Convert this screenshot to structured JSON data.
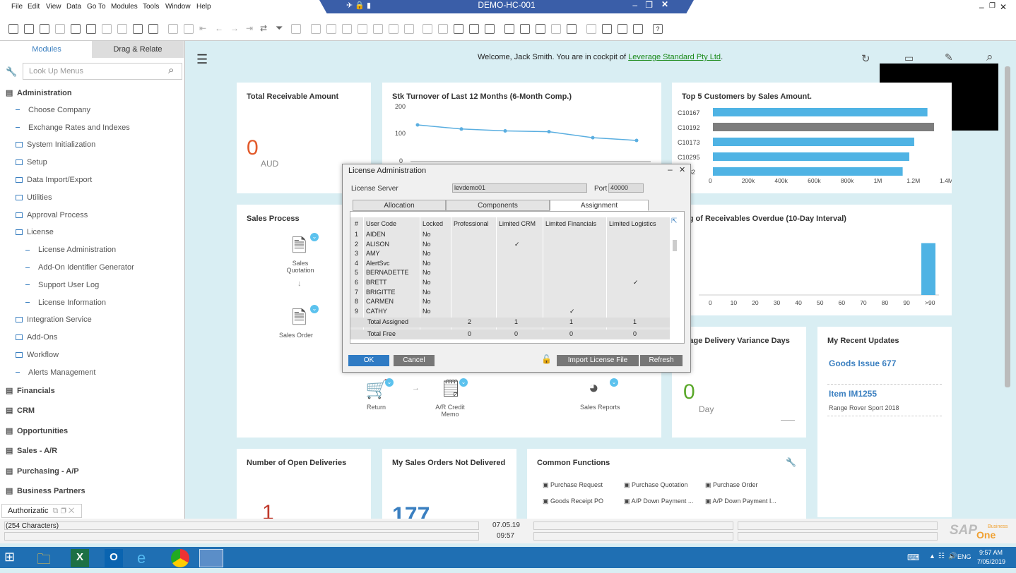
{
  "menu": [
    "File",
    "Edit",
    "View",
    "Data",
    "Go To",
    "Modules",
    "Tools",
    "Window",
    "Help"
  ],
  "window_title": "DEMO-HC-001",
  "sidebar": {
    "tabs": [
      "Modules",
      "Drag & Relate"
    ],
    "search_placeholder": "Look Up Menus",
    "items": [
      {
        "label": "Administration",
        "level": "top"
      },
      {
        "label": "Choose Company",
        "level": "leaf"
      },
      {
        "label": "Exchange Rates and Indexes",
        "level": "leaf"
      },
      {
        "label": "System Initialization",
        "level": "folder"
      },
      {
        "label": "Setup",
        "level": "folder"
      },
      {
        "label": "Data Import/Export",
        "level": "folder"
      },
      {
        "label": "Utilities",
        "level": "folder"
      },
      {
        "label": "Approval Process",
        "level": "folder"
      },
      {
        "label": "License",
        "level": "folder"
      },
      {
        "label": "License Administration",
        "level": "subleaf"
      },
      {
        "label": "Add-On Identifier Generator",
        "level": "subleaf"
      },
      {
        "label": "Support User Log",
        "level": "subleaf"
      },
      {
        "label": "License Information",
        "level": "subleaf"
      },
      {
        "label": "Integration Service",
        "level": "folder"
      },
      {
        "label": "Add-Ons",
        "level": "folder"
      },
      {
        "label": "Workflow",
        "level": "folder"
      },
      {
        "label": "Alerts Management",
        "level": "leaf"
      },
      {
        "label": "Financials",
        "level": "top"
      },
      {
        "label": "CRM",
        "level": "top"
      },
      {
        "label": "Opportunities",
        "level": "top"
      },
      {
        "label": "Sales - A/R",
        "level": "top"
      },
      {
        "label": "Purchasing - A/P",
        "level": "top"
      },
      {
        "label": "Business Partners",
        "level": "top"
      }
    ],
    "bottom_tab": "Authorizatic"
  },
  "welcome": {
    "text": "Welcome, Jack Smith. You are in cockpit of",
    "company": "Leverage Standard Pty Ltd",
    "dot": "."
  },
  "cards": {
    "receivable": {
      "title": "Total Receivable Amount",
      "value": "0",
      "unit": "AUD"
    },
    "turnover": {
      "title": "Stk Turnover of Last 12 Months (6-Month Comp.)",
      "yticks": [
        "200",
        "100",
        "0"
      ]
    },
    "top5": {
      "title": "Top 5 Customers by Sales Amount.",
      "customers": [
        "C10167",
        "C10192",
        "C10173",
        "C10295",
        "10282"
      ],
      "xticks": [
        "0",
        "200k",
        "400k",
        "600k",
        "800k",
        "1M",
        "1.2M",
        "1.4M"
      ]
    },
    "sales_process": {
      "title": "Sales Process",
      "quotation": "Sales Quotation",
      "order": "Sales Order",
      "return": "Return",
      "credit": "A/R Credit Memo",
      "reports": "Sales Reports"
    },
    "aging": {
      "title": "ing of Receivables Overdue (10-Day Interval)",
      "xticks": [
        "0",
        "10",
        "20",
        "30",
        "40",
        "50",
        "60",
        "70",
        "80",
        "90",
        ">90"
      ]
    },
    "delivery_var": {
      "title": "erage Delivery Variance Days",
      "value": "0",
      "unit": "Day"
    },
    "recent": {
      "title": "My Recent Updates",
      "item1": "Goods Issue 677",
      "item2": "Item IM1255",
      "item2_sub": "Range Rover Sport 2018"
    },
    "open_deliveries": {
      "title": "Number of Open Deliveries",
      "value": "1"
    },
    "not_delivered": {
      "title": "My Sales Orders Not Delivered",
      "value": "177"
    },
    "common": {
      "title": "Common Functions",
      "f": [
        "Purchase Request",
        "Purchase Quotation",
        "Purchase Order",
        "Goods Receipt PO",
        "A/P Down Payment ...",
        "A/P Down Payment I..."
      ]
    }
  },
  "chart_data": [
    {
      "type": "line",
      "title": "Stk Turnover of Last 12 Months (6-Month Comp.)",
      "x": [
        1,
        2,
        3,
        4,
        5,
        6
      ],
      "values": [
        135,
        120,
        113,
        110,
        88,
        78
      ],
      "ylim": [
        0,
        200
      ]
    },
    {
      "type": "bar",
      "title": "Top 5 Customers by Sales Amount.",
      "categories": [
        "C10167",
        "C10192",
        "C10173",
        "C10295",
        "10282"
      ],
      "values": [
        1300000,
        1340000,
        1220000,
        1190000,
        1150000
      ],
      "xlim": [
        0,
        1400000
      ]
    },
    {
      "type": "bar",
      "title": "ing of Receivables Overdue (10-Day Interval)",
      "categories": [
        "0",
        "10",
        "20",
        "30",
        "40",
        "50",
        "60",
        "70",
        "80",
        "90",
        ">90"
      ],
      "values": [
        0,
        0,
        0,
        0,
        0,
        0,
        0,
        0,
        0,
        0,
        0.75
      ],
      "ylim": [
        0,
        1
      ]
    }
  ],
  "dialog": {
    "title": "License Administration",
    "server_label": "License Server",
    "server_value": "levdemo01",
    "port_label": "Port",
    "port_value": "40000",
    "tabs": [
      "Allocation",
      "Components",
      "Assignment"
    ],
    "columns": [
      "#",
      "User Code",
      "Locked",
      "Professional",
      "Limited CRM",
      "Limited Financials",
      "Limited Logistics"
    ],
    "rows": [
      [
        "1",
        "AIDEN",
        "No",
        "",
        "",
        "",
        ""
      ],
      [
        "2",
        "ALISON",
        "No",
        "",
        "✓",
        "",
        ""
      ],
      [
        "3",
        "AMY",
        "No",
        "",
        "",
        "",
        ""
      ],
      [
        "4",
        "AlertSvc",
        "No",
        "",
        "",
        "",
        ""
      ],
      [
        "5",
        "BERNADETTE",
        "No",
        "",
        "",
        "",
        ""
      ],
      [
        "6",
        "BRETT",
        "No",
        "",
        "",
        "",
        "✓"
      ],
      [
        "7",
        "BRIGITTE",
        "No",
        "",
        "",
        "",
        ""
      ],
      [
        "8",
        "CARMEN",
        "No",
        "",
        "",
        "",
        ""
      ],
      [
        "9",
        "CATHY",
        "No",
        "",
        "",
        "✓",
        ""
      ]
    ],
    "total_assigned": {
      "label": "Total Assigned",
      "values": [
        "2",
        "1",
        "1",
        "1"
      ]
    },
    "total_free": {
      "label": "Total Free",
      "values": [
        "0",
        "0",
        "0",
        "0"
      ]
    },
    "ok": "OK",
    "cancel": "Cancel",
    "import": "Import License File",
    "refresh": "Refresh"
  },
  "status": {
    "chars": "(254 Characters)",
    "date": "07.05.19",
    "time": "09:57"
  },
  "taskbar": {
    "lang": "ENG",
    "time": "9:57 AM",
    "date": "7/05/2019"
  },
  "brand": {
    "sap": "SAP",
    "business": "Business",
    "one": "One"
  }
}
